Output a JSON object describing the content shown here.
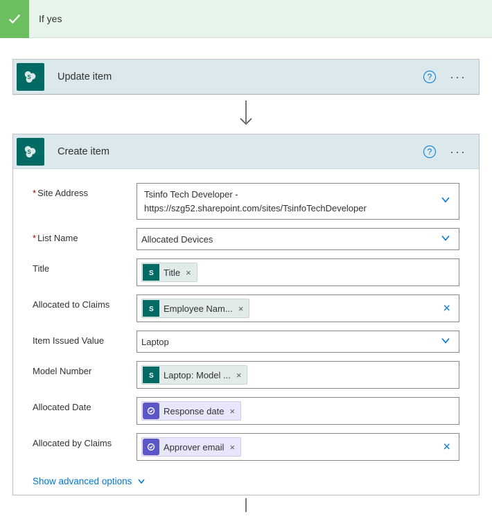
{
  "condition": {
    "title": "If yes"
  },
  "update_action": {
    "title": "Update item"
  },
  "create_action": {
    "title": "Create item",
    "fields": {
      "site_address": {
        "label": "Site Address",
        "line1": "Tsinfo Tech Developer -",
        "line2": "https://szg52.sharepoint.com/sites/TsinfoTechDeveloper"
      },
      "list_name": {
        "label": "List Name",
        "value": "Allocated Devices"
      },
      "title": {
        "label": "Title",
        "token": "Title"
      },
      "allocated_to": {
        "label": "Allocated to Claims",
        "token": "Employee Nam..."
      },
      "item_issued": {
        "label": "Item Issued Value",
        "value": "Laptop"
      },
      "model_number": {
        "label": "Model Number",
        "token": "Laptop: Model ..."
      },
      "allocated_date": {
        "label": "Allocated Date",
        "token": "Response date"
      },
      "allocated_by": {
        "label": "Allocated by Claims",
        "token": "Approver email"
      }
    },
    "advanced": "Show advanced options"
  }
}
